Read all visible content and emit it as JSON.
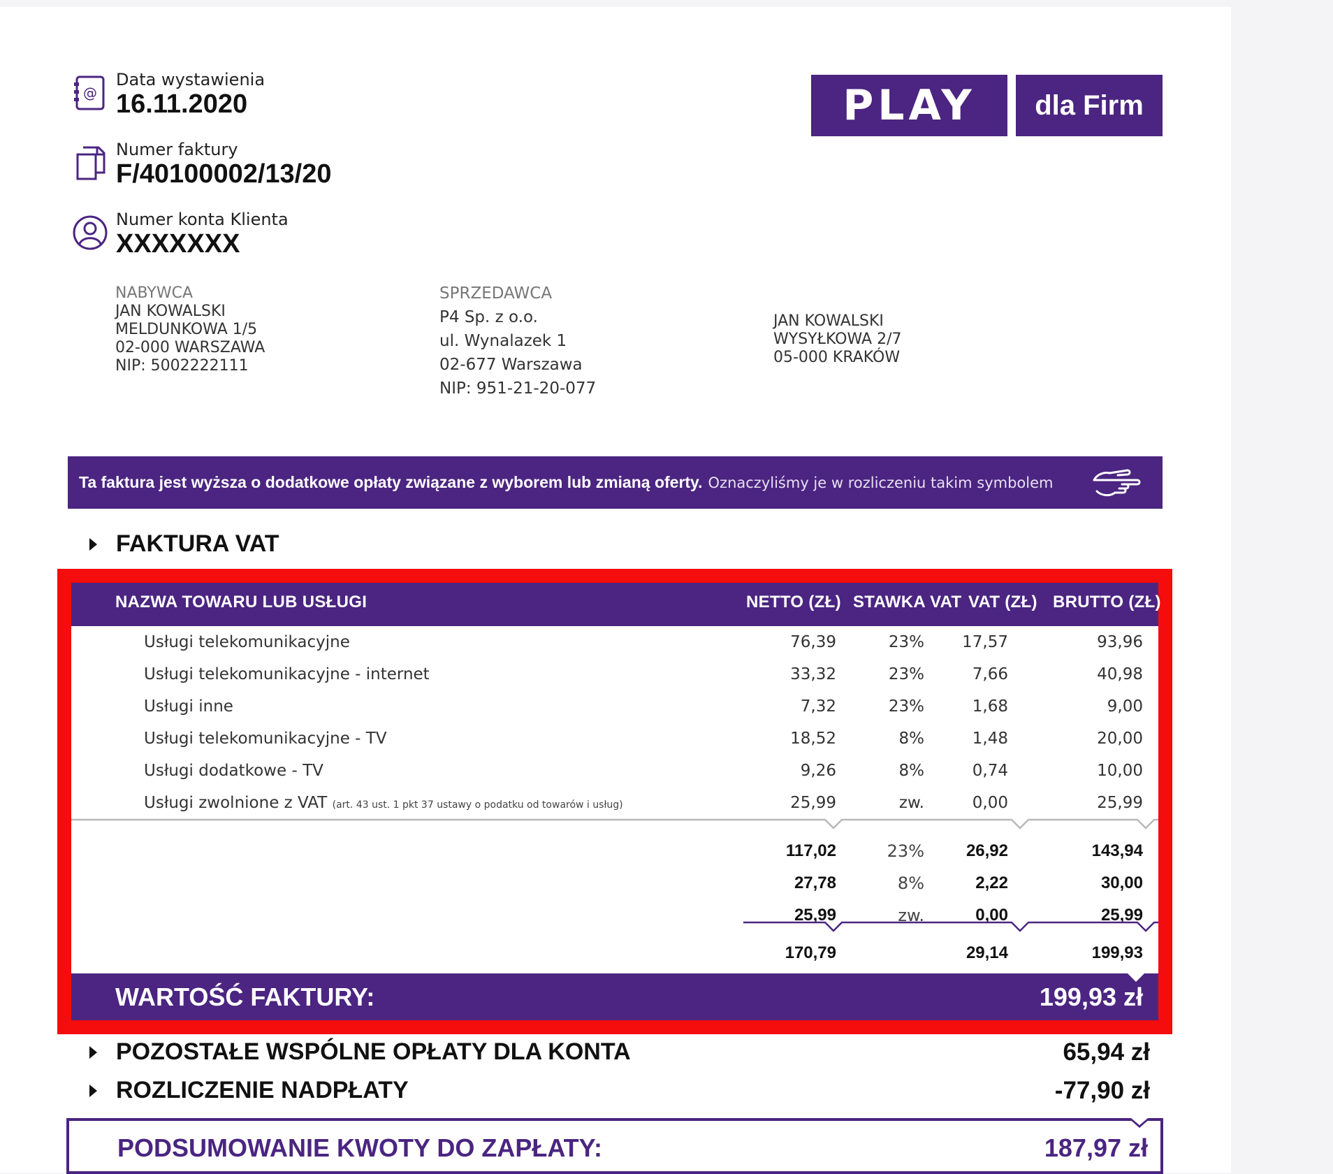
{
  "invoice": {
    "date_label": "Data wystawienia",
    "date_value": "16.11.2020",
    "number_label": "Numer faktury",
    "number_value": "F/40100002/13/20",
    "account_label": "Numer konta Klienta",
    "account_value": "XXXXXXX"
  },
  "logo": {
    "brand": "PLAY",
    "segment": "dla Firm"
  },
  "colors": {
    "brand_purple": "#4b2581",
    "highlight_red": "#f50c0c"
  },
  "buyer": {
    "heading": "NABYWCA",
    "lines": [
      "JAN KOWALSKI",
      "MELDUNKOWA 1/5",
      "02-000 WARSZAWA",
      "NIP: 5002222111"
    ]
  },
  "seller": {
    "heading": "SPRZEDAWCA",
    "lines": [
      "P4 Sp. z o.o.",
      "ul. Wynalazek 1",
      "02-677 Warszawa",
      "NIP: 951-21-20-077"
    ]
  },
  "shipping": {
    "lines": [
      "JAN KOWALSKI",
      "WYSYŁKOWA 2/7",
      "05-000 KRAKÓW"
    ]
  },
  "banner": {
    "bold_text": "Ta faktura jest wyższa o dodatkowe opłaty związane z wyborem lub zmianą oferty.",
    "light_text": "Oznaczyliśmy je w rozliczeniu takim symbolem",
    "icon": "pointing-hand-icon"
  },
  "sections": {
    "vat_title": "FAKTURA VAT",
    "other_title": "POZOSTAŁE WSPÓLNE OPŁATY DLA KONTA",
    "other_amount": "65,94 zł",
    "overpay_title": "ROZLICZENIE NADPŁATY",
    "overpay_amount": "-77,90 zł"
  },
  "table": {
    "headers": {
      "name": "NAZWA TOWARU LUB USŁUGI",
      "netto": "NETTO (ZŁ)",
      "rate": "STAWKA VAT",
      "vat": "VAT (ZŁ)",
      "brutto": "BRUTTO (ZŁ)"
    },
    "rows": [
      {
        "name": "Usługi telekomunikacyjne",
        "note": "",
        "netto": "76,39",
        "rate": "23%",
        "vat": "17,57",
        "brutto": "93,96"
      },
      {
        "name": "Usługi telekomunikacyjne - internet",
        "note": "",
        "netto": "33,32",
        "rate": "23%",
        "vat": "7,66",
        "brutto": "40,98"
      },
      {
        "name": "Usługi inne",
        "note": "",
        "netto": "7,32",
        "rate": "23%",
        "vat": "1,68",
        "brutto": "9,00"
      },
      {
        "name": "Usługi telekomunikacyjne - TV",
        "note": "",
        "netto": "18,52",
        "rate": "8%",
        "vat": "1,48",
        "brutto": "20,00"
      },
      {
        "name": "Usługi dodatkowe - TV",
        "note": "",
        "netto": "9,26",
        "rate": "8%",
        "vat": "0,74",
        "brutto": "10,00"
      },
      {
        "name": "Usługi zwolnione z VAT",
        "note": "(art. 43 ust. 1 pkt 37 ustawy o podatku od towarów i usług)",
        "netto": "25,99",
        "rate": "zw.",
        "vat": "0,00",
        "brutto": "25,99"
      }
    ],
    "subtotals": [
      {
        "netto": "117,02",
        "rate": "23%",
        "vat": "26,92",
        "brutto": "143,94"
      },
      {
        "netto": "27,78",
        "rate": "8%",
        "vat": "2,22",
        "brutto": "30,00"
      },
      {
        "netto": "25,99",
        "rate": "zw.",
        "vat": "0,00",
        "brutto": "25,99"
      }
    ],
    "totals": {
      "netto": "170,79",
      "vat": "29,14",
      "brutto": "199,93"
    },
    "invoice_value_label": "WARTOŚĆ FAKTURY:",
    "invoice_value": "199,93 zł"
  },
  "payment": {
    "label": "PODSUMOWANIE KWOTY DO ZAPŁATY:",
    "value": "187,97 zł"
  }
}
